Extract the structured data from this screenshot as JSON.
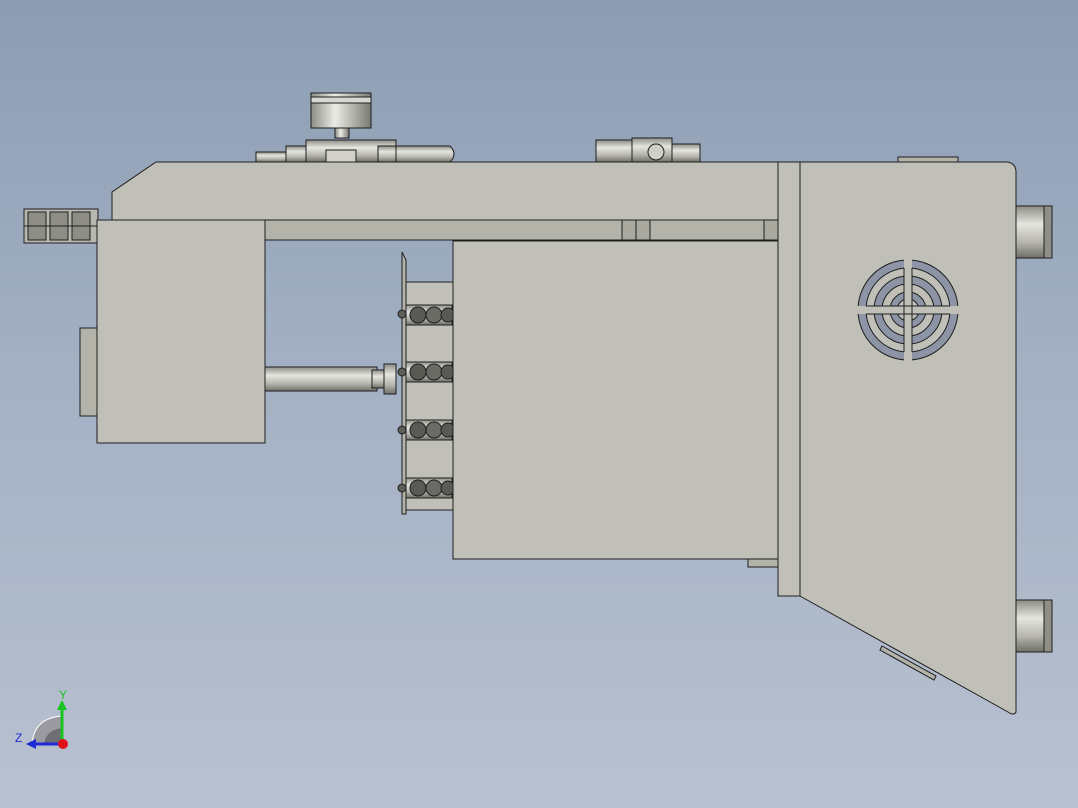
{
  "triad": {
    "y_label": "Y",
    "z_label": "Z",
    "y_color": "#18c41f",
    "z_color": "#1e2bd6",
    "x_color": "#e0101a"
  },
  "colors": {
    "background_top": "#8c9db3",
    "background_bottom": "#b8c1d1",
    "part_fill": "#c0c0b8",
    "edge": "#1e1e1e"
  }
}
